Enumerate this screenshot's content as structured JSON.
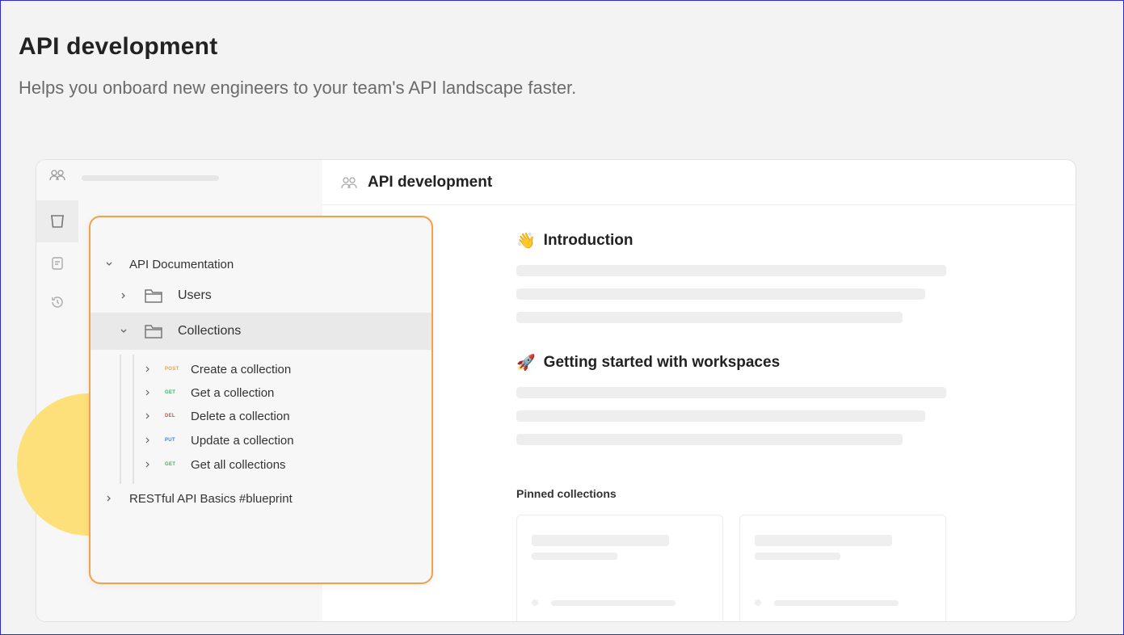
{
  "page": {
    "title": "API development",
    "subtitle": "Helps you onboard new engineers to your team's API landscape faster."
  },
  "workspace": {
    "title": "API development",
    "icon": "team-icon"
  },
  "tree": {
    "root_label": "API Documentation",
    "folders": [
      {
        "label": "Users",
        "expanded": false
      },
      {
        "label": "Collections",
        "expanded": true
      }
    ],
    "requests": [
      {
        "method": "POST",
        "label": "Create a collection",
        "color": "#e8a23a"
      },
      {
        "method": "GET",
        "label": "Get a collection",
        "color": "#2fb36a"
      },
      {
        "method": "DEL",
        "label": "Delete a collection",
        "color": "#e5483f"
      },
      {
        "method": "PUT",
        "label": "Update a collection",
        "color": "#3a7fe0"
      },
      {
        "method": "GET",
        "label": "Get all collections",
        "color": "#2fb36a"
      }
    ],
    "other_collection": "RESTful API Basics #blueprint"
  },
  "content": {
    "sections": [
      {
        "emoji": "👋",
        "title": "Introduction"
      },
      {
        "emoji": "🚀",
        "title": "Getting started with workspaces"
      }
    ],
    "pinned_label": "Pinned collections"
  },
  "colors": {
    "accent_border": "#f3a04a",
    "highlight": "#fde07a"
  }
}
